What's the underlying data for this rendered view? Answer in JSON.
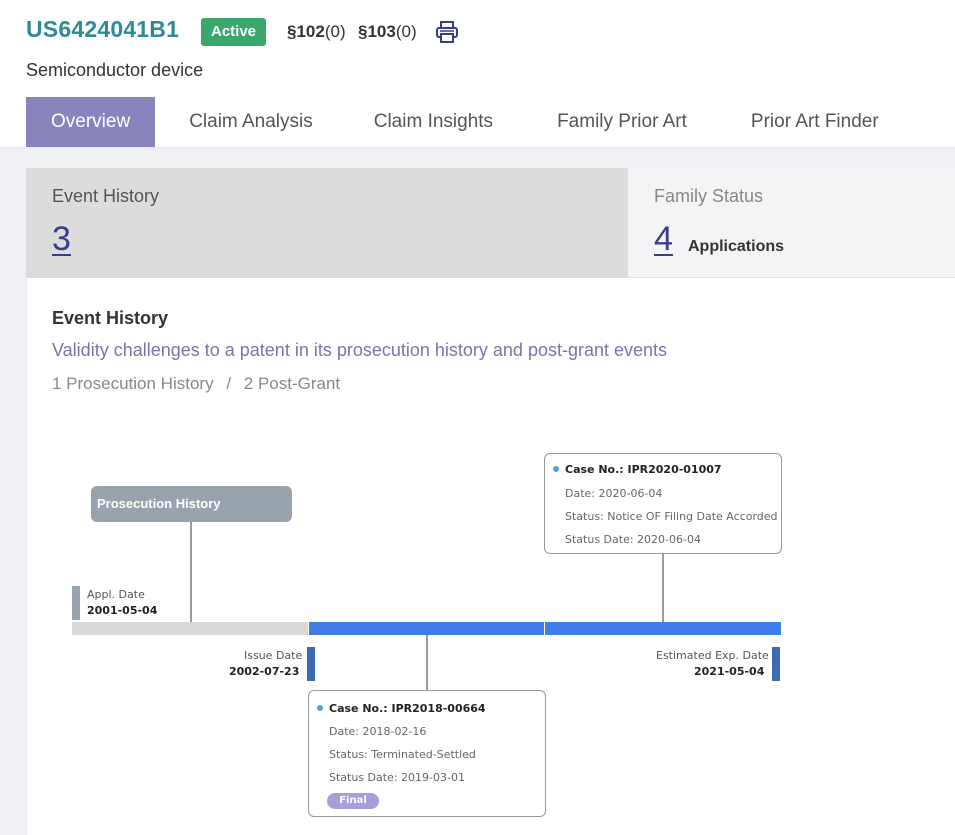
{
  "header": {
    "patent_number": "US6424041B1",
    "status_badge": "Active",
    "sec102_label": "§102",
    "sec102_count": "(0)",
    "sec103_label": "§103",
    "sec103_count": "(0)",
    "print_icon": "printer-icon",
    "title": "Semiconductor device"
  },
  "tabs": [
    {
      "label": "Overview",
      "active": true
    },
    {
      "label": "Claim Analysis",
      "active": false
    },
    {
      "label": "Claim Insights",
      "active": false
    },
    {
      "label": "Family Prior Art",
      "active": false
    },
    {
      "label": "Prior Art Finder",
      "active": false
    }
  ],
  "cards": {
    "event_history": {
      "title": "Event History",
      "count": "3"
    },
    "family_status": {
      "title": "Family Status",
      "count": "4",
      "unit": "Applications"
    }
  },
  "event_section": {
    "title": "Event History",
    "description": "Validity challenges to a patent in its prosecution history and post-grant events",
    "breadcrumb_1": "1 Prosecution History",
    "breadcrumb_sep": "/",
    "breadcrumb_2": "2 Post-Grant"
  },
  "timeline": {
    "prosecution_label": "Prosecution History",
    "appl_date_label": "Appl. Date",
    "appl_date": "2001-05-04",
    "issue_date_label": "Issue Date",
    "issue_date": "2002-07-23",
    "exp_date_label": "Estimated Exp. Date",
    "exp_date": "2021-05-04",
    "colors": {
      "prosecution": "#d9d9d9",
      "post_grant": "#3f7de8",
      "marker_gray": "#9aa4ae",
      "marker_blue": "#3c6bb0"
    },
    "case_1": {
      "case_label": "Case No.: IPR2020-01007",
      "date": "Date: 2020-06-04",
      "status": "Status: Notice OF Filing Date Accorded",
      "status_date": "Status Date: 2020-06-04"
    },
    "case_2": {
      "case_label": "Case No.: IPR2018-00664",
      "date": "Date: 2018-02-16",
      "status": "Status: Terminated-Settled",
      "status_date": "Status Date: 2019-03-01",
      "badge": "Final"
    }
  }
}
